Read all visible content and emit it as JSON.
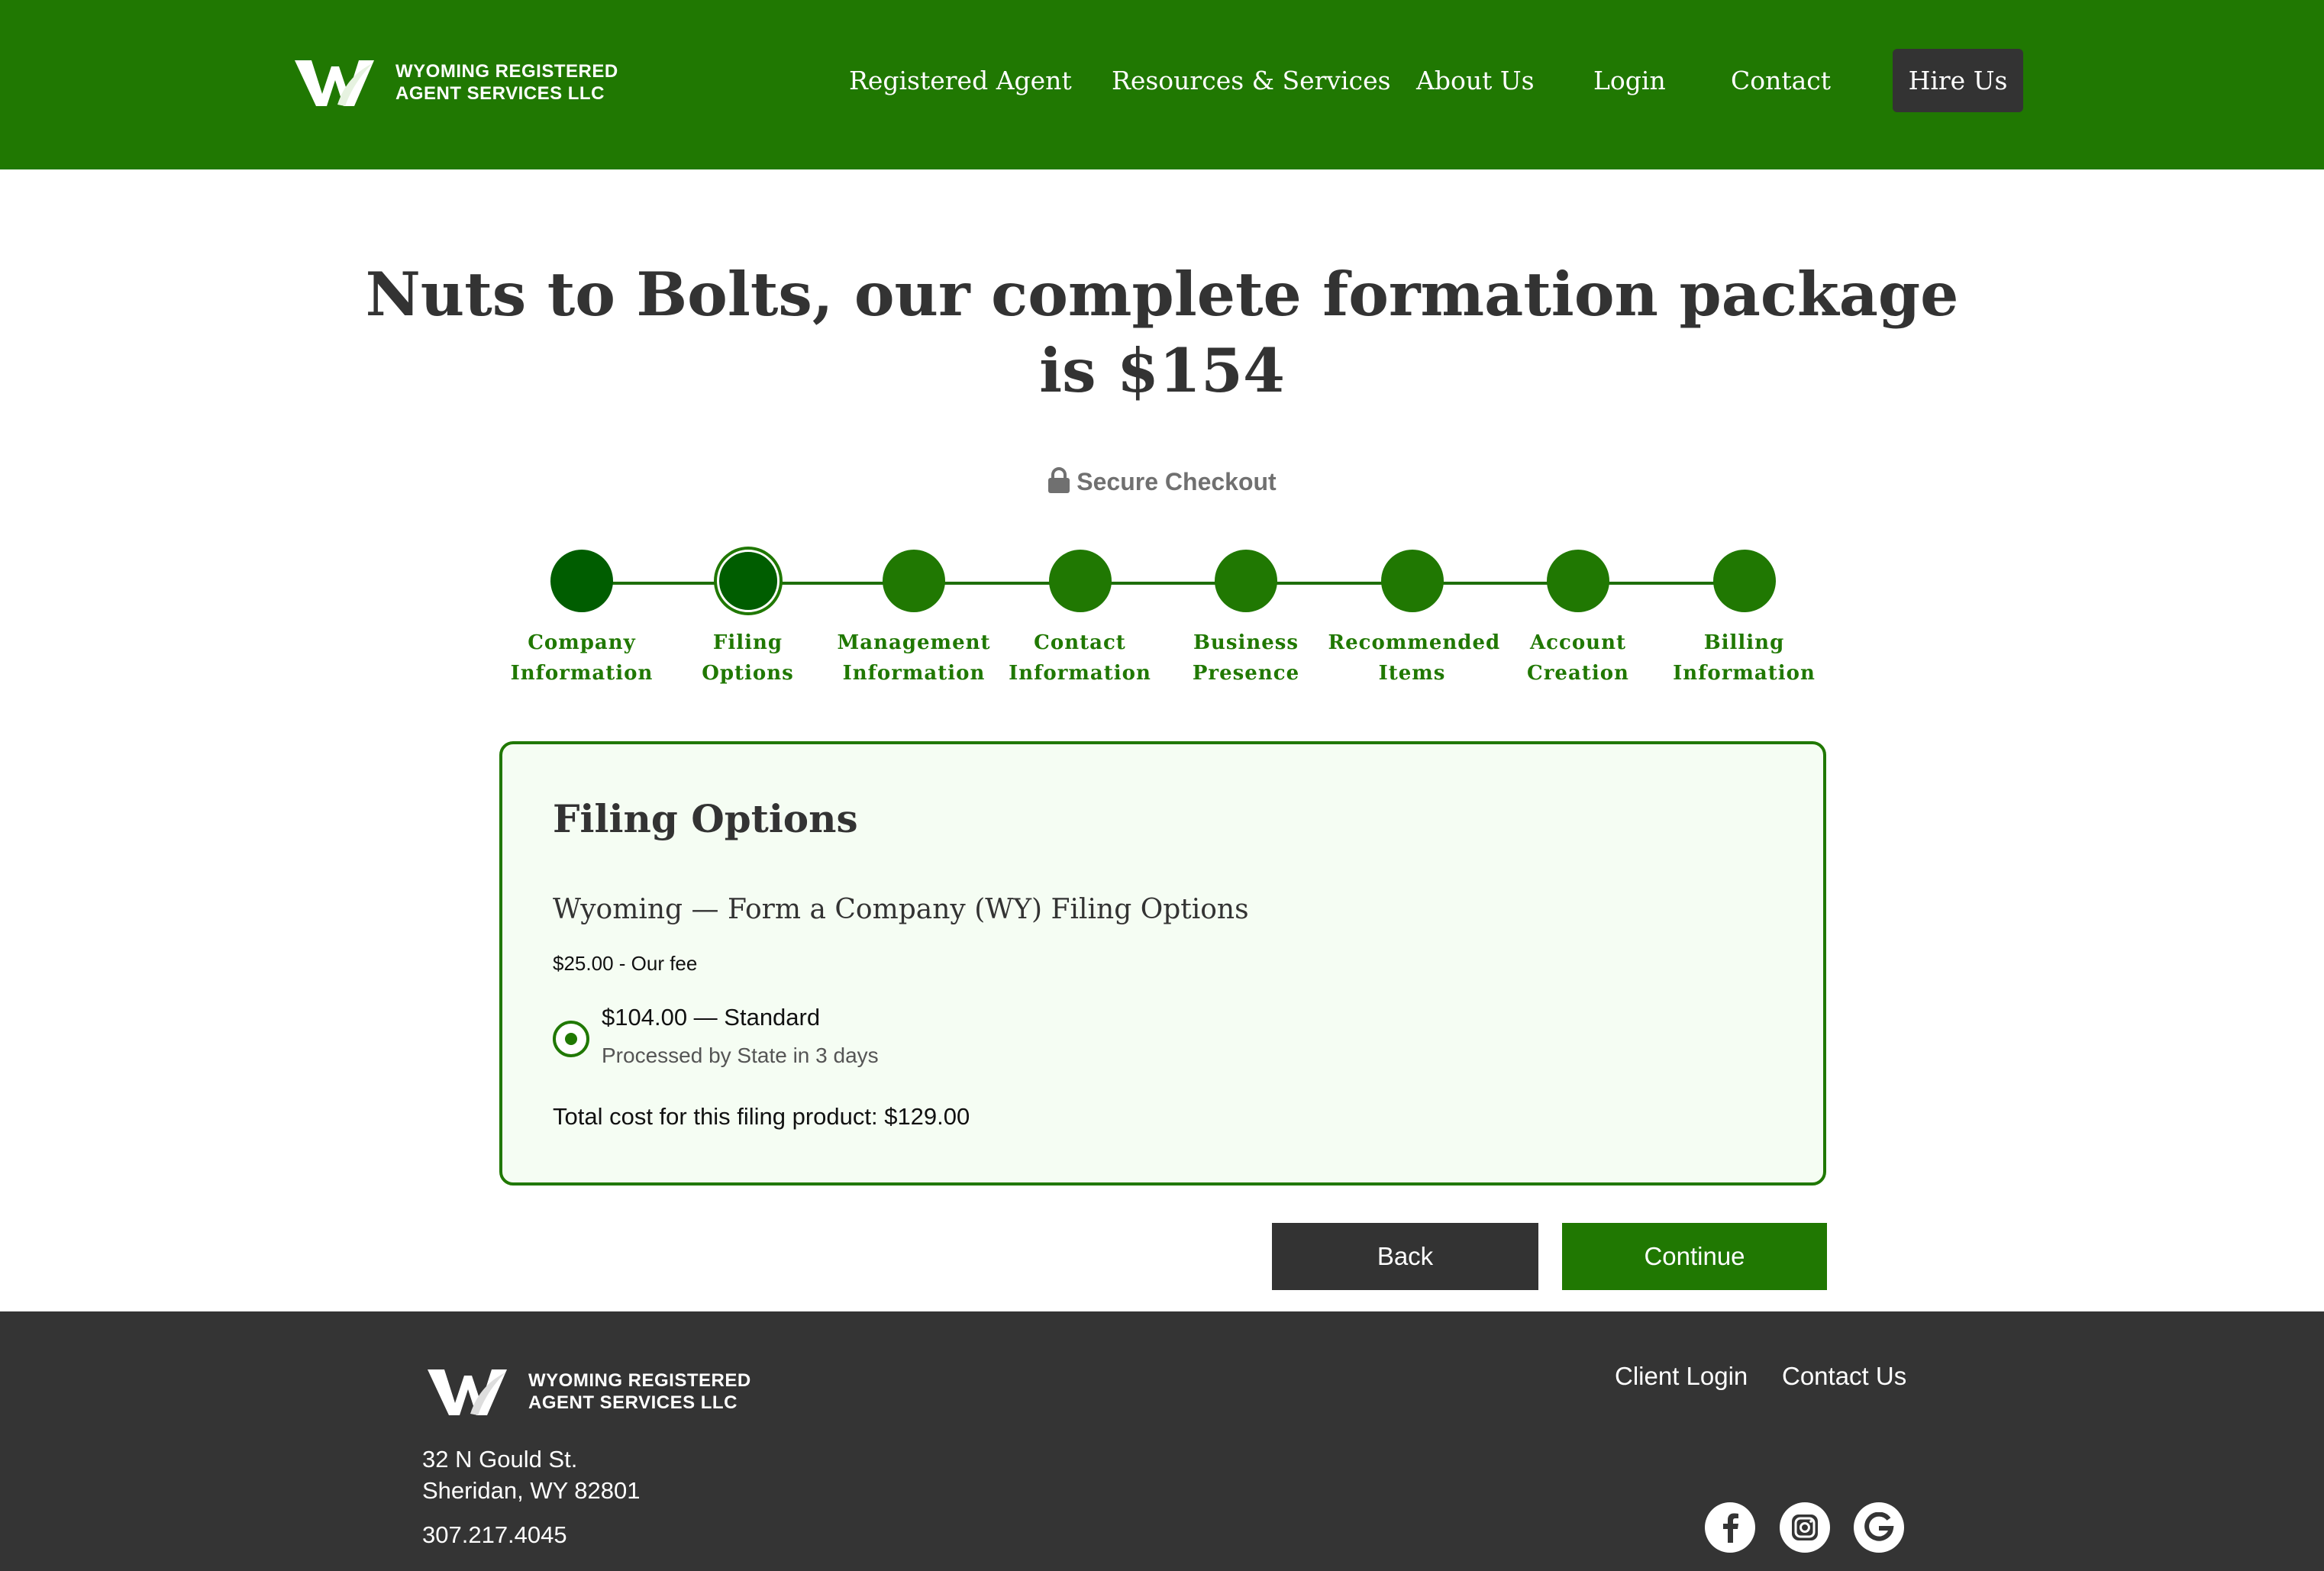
{
  "header": {
    "logo_line1": "WYOMING REGISTERED",
    "logo_line2": "AGENT SERVICES LLC",
    "nav": [
      "Registered Agent",
      "Resources & Services",
      "About Us",
      "Login",
      "Contact"
    ],
    "hire_label": "Hire Us"
  },
  "title_line1": "Nuts to Bolts, our complete formation package",
  "title_line2": "is $154",
  "secure_label": "Secure Checkout",
  "steps": [
    {
      "line1": "Company",
      "line2": "Information",
      "state": "done"
    },
    {
      "line1": "Filing",
      "line2": "Options",
      "state": "active"
    },
    {
      "line1": "Management",
      "line2": "Information",
      "state": "todo"
    },
    {
      "line1": "Contact",
      "line2": "Information",
      "state": "todo"
    },
    {
      "line1": "Business",
      "line2": "Presence",
      "state": "todo"
    },
    {
      "line1": "Recommended",
      "line2": "Items",
      "state": "todo"
    },
    {
      "line1": "Account",
      "line2": "Creation",
      "state": "todo"
    },
    {
      "line1": "Billing",
      "line2": "Information",
      "state": "todo"
    }
  ],
  "card": {
    "title": "Filing Options",
    "subtitle": "Wyoming — Form a Company (WY) Filing Options",
    "fee": "$25.00 - Our fee",
    "option_label": "$104.00 — Standard",
    "option_note": "Processed by State in 3 days",
    "total": "Total cost for this filing product: $129.00"
  },
  "buttons": {
    "back": "Back",
    "continue": "Continue"
  },
  "footer": {
    "logo_line1": "WYOMING REGISTERED",
    "logo_line2": "AGENT SERVICES LLC",
    "links": [
      "Client Login",
      "Contact Us"
    ],
    "address1": "32 N Gould St.",
    "address2": "Sheridan, WY 82801",
    "phone": "307.217.4045",
    "social": [
      "facebook-icon",
      "instagram-icon",
      "google-icon"
    ]
  },
  "colors": {
    "brand_green": "#207802",
    "dark_green": "#005d00",
    "dark_gray": "#333333"
  }
}
